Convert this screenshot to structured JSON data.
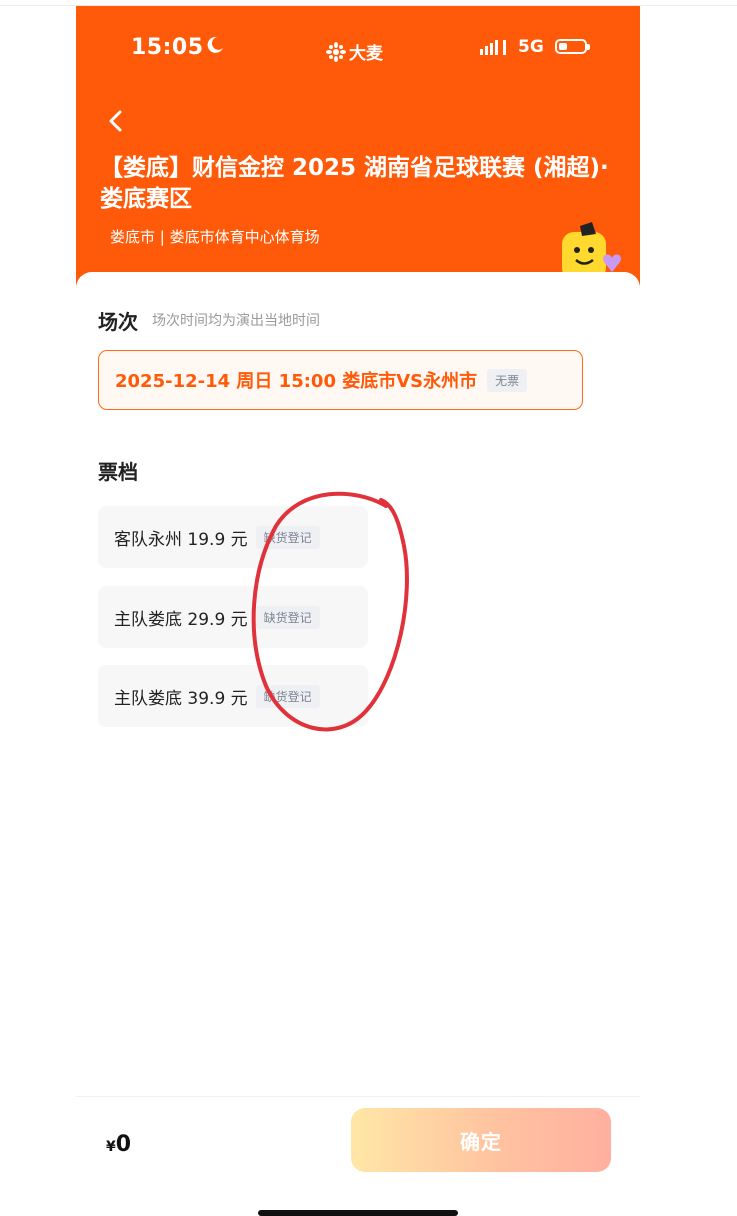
{
  "status": {
    "time": "15:05",
    "brand": "大麦",
    "network": "5G"
  },
  "header": {
    "title": "【娄底】财信金控 2025 湖南省足球联赛 (湘超)· 娄底赛区",
    "venue": "娄底市 | 娄底市体育中心体育场"
  },
  "session": {
    "label": "场次",
    "note": "场次时间均为演出当地时间",
    "option": "2025-12-14 周日 15:00 娄底市VS永州市",
    "option_tag": "无票"
  },
  "tiers": {
    "label": "票档",
    "items": [
      {
        "name": "客队永州 19.9 元",
        "tag": "缺货登记"
      },
      {
        "name": "主队娄底 29.9 元",
        "tag": "缺货登记"
      },
      {
        "name": "主队娄底 39.9 元",
        "tag": "缺货登记"
      }
    ]
  },
  "footer": {
    "currency": "¥",
    "amount": "0",
    "confirm": "确定"
  },
  "colors": {
    "brand": "#ff5a0a",
    "annotation": "#e0323a"
  }
}
